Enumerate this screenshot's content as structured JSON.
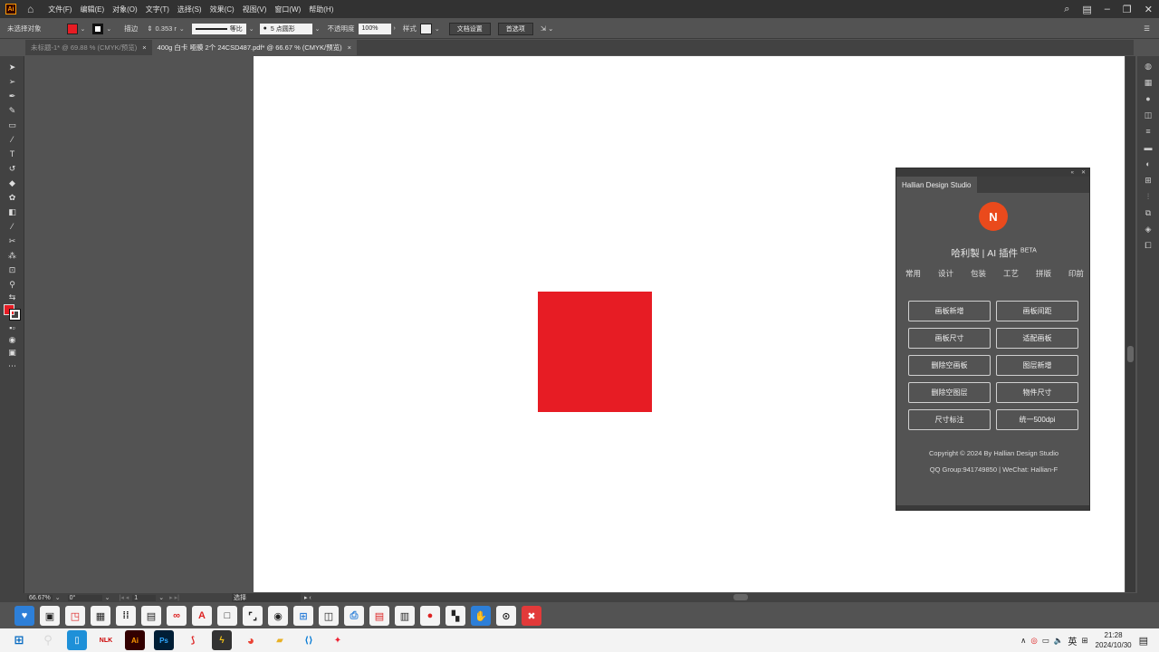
{
  "menubar": {
    "app_icon": "Ai",
    "menus": [
      "文件(F)",
      "编辑(E)",
      "对象(O)",
      "文字(T)",
      "选择(S)",
      "效果(C)",
      "视图(V)",
      "窗口(W)",
      "帮助(H)"
    ]
  },
  "controlbar": {
    "selection": "未选择对象",
    "stroke_label": "描边",
    "stroke_value": "0.353 r",
    "line_style": "等比",
    "brush": "5 点圆形",
    "opacity_label": "不透明度",
    "opacity_value": "100%",
    "style_label": "样式",
    "doc_setup": "文档设置",
    "prefs": "首选项",
    "fill_color": "#e71c24"
  },
  "tabs": [
    {
      "label": "未标题-1* @ 69.88 % (CMYK/预览)",
      "active": false
    },
    {
      "label": "400g 白卡 哑膜 2个 24CSD487.pdf* @ 66.67 % (CMYK/预览)",
      "active": true
    }
  ],
  "artwork": {
    "square_color": "#e71c24"
  },
  "panel": {
    "tab": "Hallian Design Studio",
    "logo": "N",
    "title": "哈利製 | AI 插件",
    "badge": "BETA",
    "categories": [
      "常用",
      "设计",
      "包装",
      "工艺",
      "拼版",
      "印前"
    ],
    "buttons": [
      "画板新增",
      "画板间距",
      "画板尺寸",
      "适配画板",
      "删除空画板",
      "图层新增",
      "删除空图层",
      "物件尺寸",
      "尺寸标注",
      "统一500dpi"
    ],
    "copyright": "Copyright © 2024 By Hallian Design Studio",
    "contact": "QQ Group:941749850 | WeChat: Hallian-F"
  },
  "statusbar": {
    "zoom": "66.67%",
    "rotation": "0°",
    "artboard": "1",
    "mode": "选择"
  },
  "taskbar": {
    "ime": "英",
    "time": "21:28",
    "date": "2024/10/30"
  }
}
